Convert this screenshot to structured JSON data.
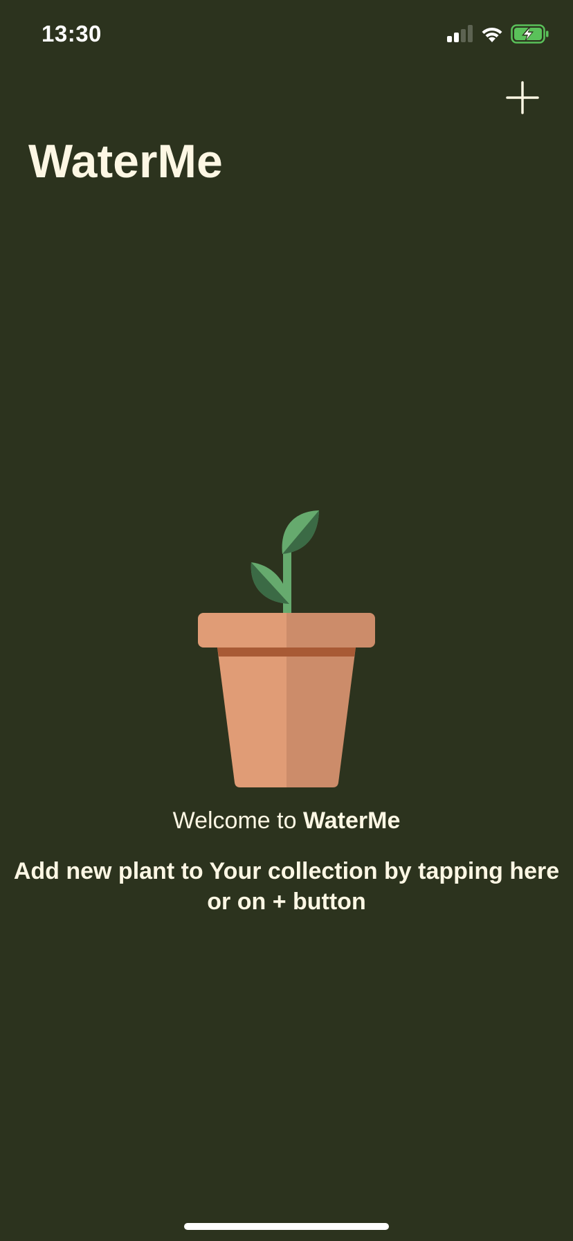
{
  "status_bar": {
    "time": "13:30",
    "signal_icon": "cellular-signal-icon",
    "wifi_icon": "wifi-icon",
    "battery_icon": "battery-charging-icon",
    "battery_color": "#5ac15a"
  },
  "header": {
    "title": "WaterMe",
    "add_icon": "plus-icon"
  },
  "empty_state": {
    "illustration": "potted-plant-icon",
    "welcome_prefix": "Welcome to ",
    "welcome_app_name": "WaterMe",
    "hint": "Add new plant to Your collection by tapping here or on + button"
  },
  "theme": {
    "background": "#2c331e",
    "text": "#fdf7e4",
    "pot_light": "#e09c76",
    "pot_shade": "#cc8c6a",
    "pot_rim_band": "#a85a35",
    "leaf_light": "#66aa6e",
    "leaf_dark": "#3b6a45"
  }
}
